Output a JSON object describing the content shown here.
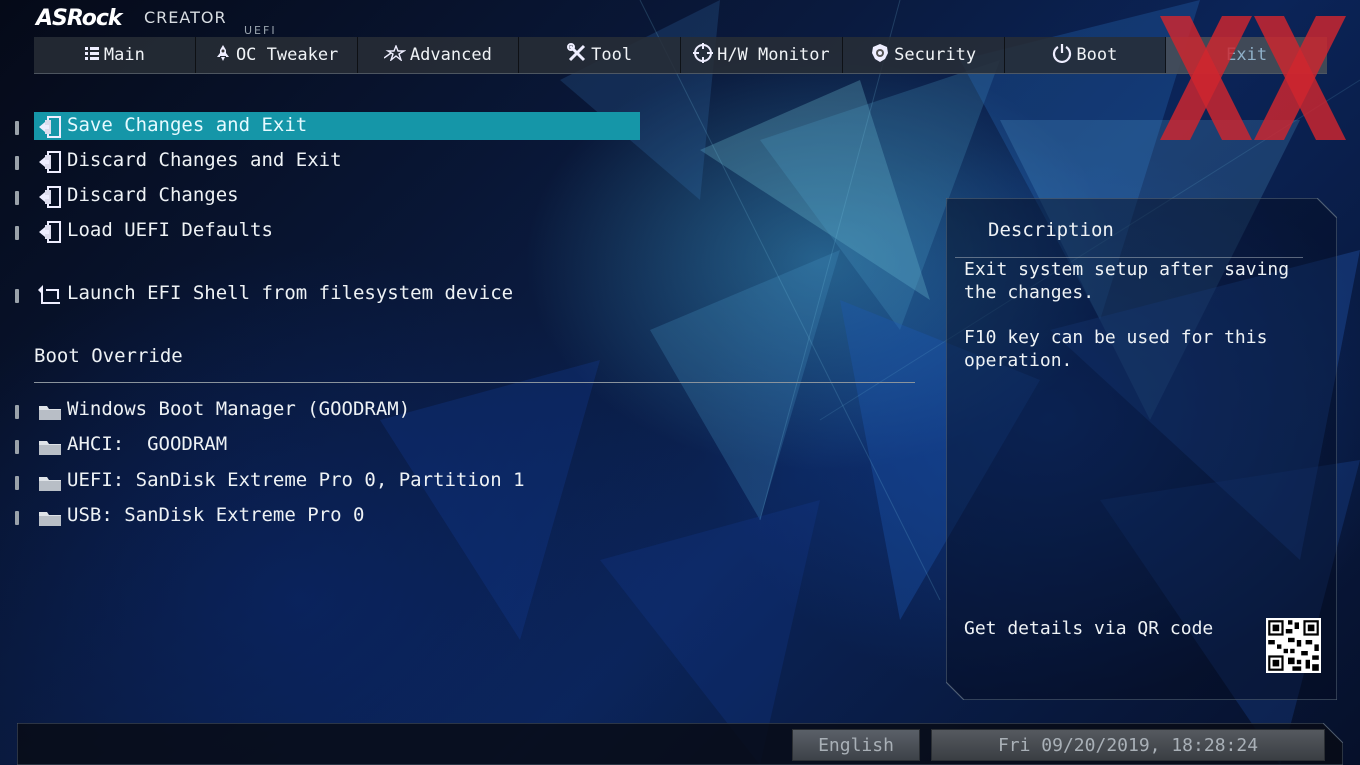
{
  "logo": {
    "brand": "ASRock",
    "product": "CREATOR",
    "firmware": "UEFI"
  },
  "tabs": [
    {
      "label": "Main",
      "icon": "list-icon"
    },
    {
      "label": "OC Tweaker",
      "icon": "rocket-icon"
    },
    {
      "label": "Advanced",
      "icon": "star-icon"
    },
    {
      "label": "Tool",
      "icon": "tools-icon"
    },
    {
      "label": "H/W Monitor",
      "icon": "crosshair-icon"
    },
    {
      "label": "Security",
      "icon": "shield-icon"
    },
    {
      "label": "Boot",
      "icon": "power-icon"
    },
    {
      "label": "Exit",
      "icon": "",
      "active": true
    }
  ],
  "menu": {
    "items": [
      {
        "label": "Save Changes and Exit",
        "selected": true
      },
      {
        "label": "Discard Changes and Exit"
      },
      {
        "label": "Discard Changes"
      },
      {
        "label": "Load UEFI Defaults"
      },
      {
        "label": "Launch EFI Shell from filesystem device"
      }
    ],
    "boot_override_title": "Boot Override",
    "boot_devices": [
      {
        "label": "Windows Boot Manager (GOODRAM)"
      },
      {
        "label": "AHCI:  GOODRAM"
      },
      {
        "label": "UEFI: SanDisk Extreme Pro 0, Partition 1"
      },
      {
        "label": "USB: SanDisk Extreme Pro 0"
      }
    ]
  },
  "description": {
    "title": "Description",
    "paragraphs": [
      "Exit system setup after saving the changes.",
      "F10 key can be used for this operation."
    ],
    "qr_label": "Get details via QR code"
  },
  "footer": {
    "language": "English",
    "datetime": "Fri 09/20/2019, 18:28:24"
  },
  "colors": {
    "highlight": "#1596a8",
    "watermark": "#d0262e",
    "tab_bar": "#282e36"
  }
}
